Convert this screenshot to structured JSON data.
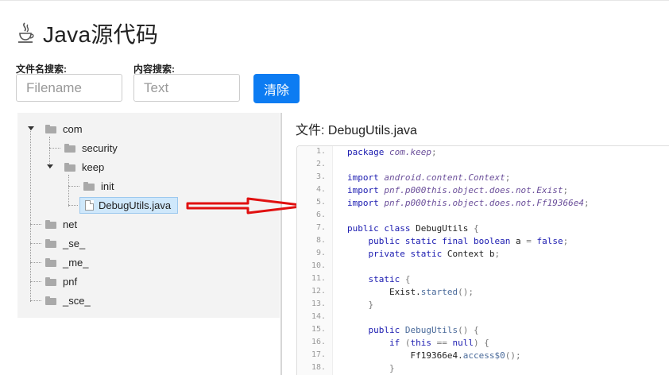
{
  "header": {
    "title": "Java源代码",
    "logo_icon": "java-coffee-icon"
  },
  "search": {
    "filename_label": "文件名搜索:",
    "filename_placeholder": "Filename",
    "content_label": "内容搜索:",
    "content_placeholder": "Text",
    "clear_button": "清除"
  },
  "tree": {
    "nodes": [
      {
        "label": "com",
        "expanded": true
      },
      {
        "label": "security"
      },
      {
        "label": "keep",
        "expanded": true
      },
      {
        "label": "init"
      },
      {
        "label": "DebugUtils.java",
        "selected": true
      },
      {
        "label": "net"
      },
      {
        "label": "_se_"
      },
      {
        "label": "_me_"
      },
      {
        "label": "pnf"
      },
      {
        "label": "_sce_"
      }
    ]
  },
  "viewer": {
    "file_label": "文件: DebugUtils.java",
    "lines": [
      {
        "n": "1.",
        "text": "package com.keep;"
      },
      {
        "n": "2.",
        "text": ""
      },
      {
        "n": "3.",
        "text": "import android.content.Context;"
      },
      {
        "n": "4.",
        "text": "import pnf.p000this.object.does.not.Exist;"
      },
      {
        "n": "5.",
        "text": "import pnf.p000this.object.does.not.Ff19366e4;"
      },
      {
        "n": "6.",
        "text": ""
      },
      {
        "n": "7.",
        "text": "public class DebugUtils {"
      },
      {
        "n": "8.",
        "text": "    public static final boolean a = false;"
      },
      {
        "n": "9.",
        "text": "    private static Context b;"
      },
      {
        "n": "10.",
        "text": ""
      },
      {
        "n": "11.",
        "text": "    static {"
      },
      {
        "n": "12.",
        "text": "        Exist.started();"
      },
      {
        "n": "13.",
        "text": "    }"
      },
      {
        "n": "14.",
        "text": ""
      },
      {
        "n": "15.",
        "text": "    public DebugUtils() {"
      },
      {
        "n": "16.",
        "text": "        if (this == null) {"
      },
      {
        "n": "17.",
        "text": "            Ff19366e4.access$0();"
      },
      {
        "n": "18.",
        "text": "        }"
      }
    ]
  },
  "colors": {
    "accent": "#0d7cf2",
    "arrow": "#e01010",
    "selected_bg": "#cfe8fb"
  }
}
